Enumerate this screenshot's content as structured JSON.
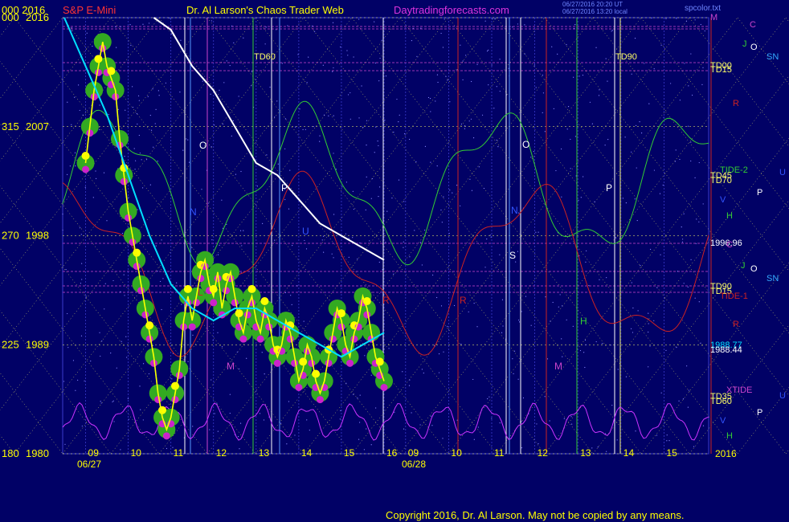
{
  "header": {
    "left_label": "000  2016",
    "title_left": "S&P E-Mini",
    "title_mid": "Dr. Al Larson's Chaos Trader Web",
    "site": "Daytradingforecasts.com",
    "timestamp1": "06/27/2016 20:20 UT",
    "timestamp2": "06/27/2016 13:20 local",
    "file": "spcolor.txt"
  },
  "copyright": "Copyright 2016, Dr. Al Larson. May not be copied by any means.",
  "colors": {
    "background": "#010166",
    "price": "#00ff00",
    "average": "#ffff00",
    "cyan_line": "#00e0ff",
    "white_line": "#ffffff",
    "magenta_osc": "#cc33ff",
    "green_wave": "#33cc33",
    "red_wave": "#cc2222",
    "grid": "#3a3acc"
  },
  "chart_data": {
    "type": "line",
    "title": "S&P E-Mini",
    "y_axis": {
      "range": [
        1980,
        2016
      ],
      "ticks": [
        {
          "left": "000",
          "value": "2016"
        },
        {
          "left": "315",
          "value": "2007"
        },
        {
          "left": "270",
          "value": "1998"
        },
        {
          "left": "225",
          "value": "1989"
        },
        {
          "left": "180",
          "value": "1980"
        }
      ]
    },
    "x_axis": {
      "hour_ticks_day1": [
        "09",
        "10",
        "11",
        "12",
        "13",
        "14",
        "15",
        "16"
      ],
      "hour_ticks_day2": [
        "09",
        "10",
        "11",
        "12",
        "13",
        "14",
        "15"
      ],
      "date_labels": [
        "06/27",
        "06/28"
      ],
      "right_value": "2016"
    },
    "series": [
      {
        "name": "price",
        "x": [
          9.0,
          9.1,
          9.2,
          9.3,
          9.4,
          9.5,
          9.6,
          9.7,
          9.8,
          9.9,
          10.0,
          10.1,
          10.2,
          10.3,
          10.4,
          10.5,
          10.6,
          10.7,
          10.8,
          10.9,
          11.0,
          11.1,
          11.2,
          11.3,
          11.4,
          11.5,
          11.6,
          11.7,
          11.8,
          11.9,
          12.0,
          12.1,
          12.2,
          12.3,
          12.4,
          12.5,
          12.6,
          12.7,
          12.8,
          12.9,
          13.0,
          13.1,
          13.2,
          13.3,
          13.4,
          13.5,
          13.6,
          13.7,
          13.8,
          13.9,
          14.0,
          14.1,
          14.2,
          14.3,
          14.4,
          14.5,
          14.6,
          14.7,
          14.8,
          14.9,
          15.0,
          15.1,
          15.2,
          15.3,
          15.4,
          15.5,
          15.6,
          15.7,
          15.8,
          15.9,
          16.0
        ],
        "values": [
          2004,
          2007,
          2010,
          2012,
          2014,
          2012,
          2011,
          2010,
          2006,
          2003,
          2000,
          1998,
          1996,
          1994,
          1992,
          1990,
          1988,
          1985,
          1983,
          1982,
          1983,
          1985,
          1987,
          1991,
          1993,
          1991,
          1993,
          1995,
          1996,
          1994,
          1993,
          1995,
          1992,
          1994,
          1995,
          1993,
          1991,
          1990,
          1992,
          1993,
          1991,
          1990,
          1992,
          1991,
          1989,
          1988,
          1989,
          1991,
          1990,
          1988,
          1986,
          1987,
          1989,
          1988,
          1986,
          1985,
          1986,
          1988,
          1990,
          1992,
          1991,
          1989,
          1988,
          1990,
          1991,
          1993,
          1992,
          1990,
          1988,
          1987,
          1986
        ]
      },
      {
        "name": "cyan",
        "x": [
          8.5,
          9.0,
          9.5,
          10.0,
          10.5,
          11.0,
          11.5,
          12.0,
          12.5,
          13.0,
          13.5,
          14.0,
          14.5,
          15.0,
          15.5,
          16.0
        ],
        "values": [
          2016,
          2012,
          2008,
          2003,
          1998,
          1994,
          1992,
          1991,
          1992,
          1992,
          1991,
          1990,
          1989,
          1988,
          1989,
          1990
        ]
      },
      {
        "name": "white",
        "x": [
          10.6,
          11.0,
          11.5,
          12.0,
          12.5,
          13.0,
          13.5,
          14.0,
          14.5,
          15.0,
          15.5,
          16.0
        ],
        "values": [
          2016,
          2015,
          2012,
          2010,
          2007,
          2004,
          2003,
          2001,
          1999,
          1998,
          1997,
          1996
        ]
      }
    ],
    "annotations": {
      "time_labels": [
        "TD60",
        "TD90"
      ],
      "right_labels": [
        {
          "text": "M",
          "color": "#cc44cc"
        },
        {
          "text": "C",
          "color": "#cc44cc"
        },
        {
          "text": "J",
          "color": "#33cc33"
        },
        {
          "text": "O",
          "color": "#ffffff"
        },
        {
          "text": "SN",
          "color": "#33aaff"
        },
        {
          "text": "TD00",
          "color": "#ffff66"
        },
        {
          "text": "TD15",
          "color": "#ffff66"
        },
        {
          "text": "R",
          "color": "#cc2222"
        },
        {
          "text": "TIDE-2",
          "color": "#33cc33"
        },
        {
          "text": "TD45",
          "color": "#ffff66"
        },
        {
          "text": "TD70",
          "color": "#ffff66"
        },
        {
          "text": "U",
          "color": "#3355ff"
        },
        {
          "text": "P",
          "color": "#ffffff"
        },
        {
          "text": "V",
          "color": "#3355ff"
        },
        {
          "text": "H",
          "color": "#33cc33"
        },
        {
          "text": "1996.96",
          "color": "#ffffff"
        },
        {
          "text": "C",
          "color": "#cc44cc"
        },
        {
          "text": "J",
          "color": "#33cc33"
        },
        {
          "text": "O",
          "color": "#ffffff"
        },
        {
          "text": "SN",
          "color": "#33aaff"
        },
        {
          "text": "TD90",
          "color": "#ffff66"
        },
        {
          "text": "TD15",
          "color": "#ffff66"
        },
        {
          "text": "TIDE-1",
          "color": "#cc2222"
        },
        {
          "text": "R",
          "color": "#cc2222"
        },
        {
          "text": "1988.77",
          "color": "#00e0ff"
        },
        {
          "text": "1988.44",
          "color": "#ffffff"
        },
        {
          "text": "XTIDE",
          "color": "#cc44cc"
        },
        {
          "text": "U",
          "color": "#3355ff"
        },
        {
          "text": "TD35",
          "color": "#ffff66"
        },
        {
          "text": "TD60",
          "color": "#ffff66"
        },
        {
          "text": "P",
          "color": "#ffffff"
        },
        {
          "text": "V",
          "color": "#3355ff"
        },
        {
          "text": "H",
          "color": "#33cc33"
        }
      ],
      "in_chart_labels": [
        "O",
        "P",
        "N",
        "U",
        "L",
        "M",
        "R",
        "S",
        "O",
        "P",
        "N",
        "H",
        "M",
        "R"
      ]
    }
  }
}
